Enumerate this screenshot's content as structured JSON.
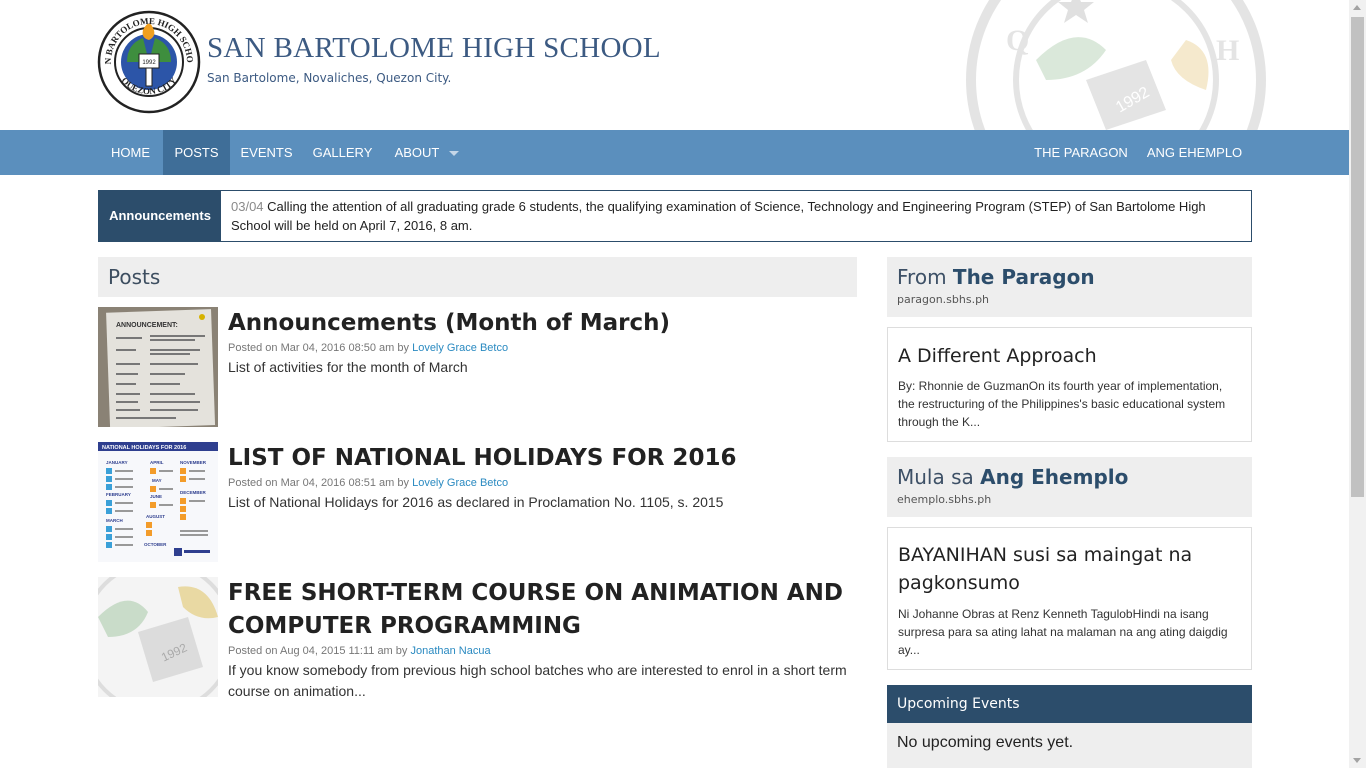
{
  "header": {
    "title": "SAN BARTOLOME HIGH SCHOOL",
    "tagline": "San Bartolome, Novaliches, Quezon City.",
    "logo": {
      "top_text": "SAN BARTOLOME HIGH SCHOOL",
      "bottom_text": "QUEZON CITY",
      "year": "1992"
    }
  },
  "nav": {
    "items": [
      {
        "label": "HOME"
      },
      {
        "label": "POSTS"
      },
      {
        "label": "EVENTS"
      },
      {
        "label": "GALLERY"
      },
      {
        "label": "ABOUT"
      },
      {
        "label": "THE PARAGON"
      },
      {
        "label": "ANG EHEMPLO"
      }
    ],
    "active": "POSTS"
  },
  "announcement": {
    "label": "Announcements",
    "date": "03/04",
    "text": "Calling the attention of all graduating grade 6 students, the qualifying examination of Science, Technology and Engineering Program (STEP) of San Bartolome High School will be held on April 7, 2016, 8 am."
  },
  "posts": {
    "heading": "Posts",
    "items": [
      {
        "title": "Announcements (Month of March)",
        "meta_prefix": "Posted on Mar 04, 2016 08:50 am by",
        "author": "Lovely Grace Betco",
        "excerpt": "List of activities for the month of March",
        "thumb": {
          "heading": "ANNOUNCEMENT:"
        }
      },
      {
        "title": "LIST OF NATIONAL HOLIDAYS FOR 2016",
        "meta_prefix": "Posted on Mar 04, 2016 08:51 am by",
        "author": "Lovely Grace Betco",
        "excerpt": "List of National Holidays for 2016 as declared in Proclamation No. 1105, s. 2015",
        "thumb": {
          "heading": "NATIONAL HOLIDAYS FOR 2016",
          "months_left": [
            "JANUARY",
            "FEBRUARY",
            "MARCH"
          ],
          "months_mid": [
            "APRIL",
            "MAY",
            "JUNE",
            "AUGUST",
            "OCTOBER"
          ],
          "months_right": [
            "NOVEMBER",
            "DECEMBER"
          ]
        }
      },
      {
        "title": "FREE SHORT-TERM COURSE ON ANIMATION AND COMPUTER PROGRAMMING",
        "meta_prefix": "Posted on Aug 04, 2015 11:11 am by",
        "author": "Jonathan Nacua",
        "excerpt": "If you know somebody from previous high school batches who are interested to enrol in a short term course on animation...",
        "thumb": {
          "year": "1992"
        }
      }
    ]
  },
  "sidebar": {
    "paragon": {
      "prefix": "From",
      "name": "The Paragon",
      "url": "paragon.sbhs.ph",
      "article_title": "A Different Approach",
      "article_text": "By: Rhonnie de GuzmanOn its fourth year of implementation, the restructuring of the Philippines's basic educational system through the K..."
    },
    "ehemplo": {
      "prefix": "Mula sa",
      "name": "Ang Ehemplo",
      "url": "ehemplo.sbhs.ph",
      "article_title": "BAYANIHAN susi sa maingat na pagkonsumo",
      "article_text": "Ni Johanne Obras at Renz Kenneth TagulobHindi na isang surpresa para sa ating lahat na malaman na ang ating daigdig ay..."
    },
    "events": {
      "heading": "Upcoming Events",
      "empty_text": "No upcoming events yet."
    }
  },
  "colors": {
    "nav_bg": "#5b8fbd",
    "nav_active": "#3f6e98",
    "dark_blue": "#2c4d6b",
    "link": "#2a8ac1",
    "title_blue": "#3c5a82"
  }
}
